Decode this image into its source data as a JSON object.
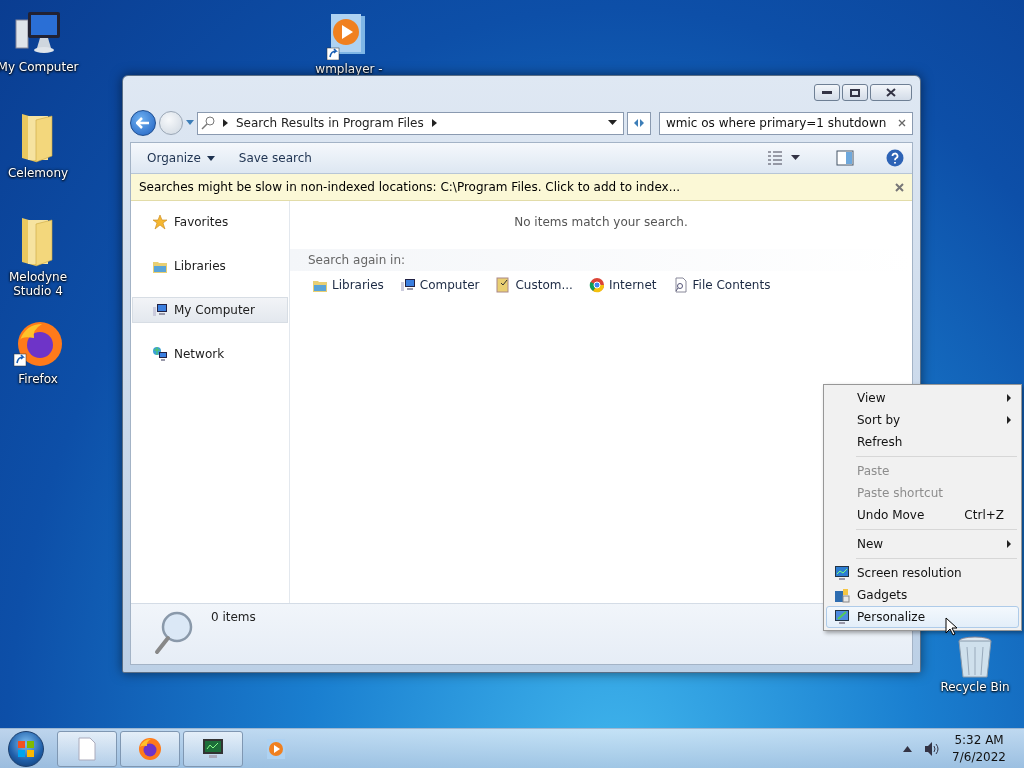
{
  "desktop_icons": [
    {
      "label": "My Computer",
      "kind": "computer"
    },
    {
      "label": "wmplayer -",
      "kind": "media"
    },
    {
      "label": "Celemony",
      "kind": "folder"
    },
    {
      "label": "Melodyne\nStudio 4",
      "kind": "folder"
    },
    {
      "label": "Firefox",
      "kind": "firefox"
    },
    {
      "label": "Recycle Bin",
      "kind": "recycle"
    }
  ],
  "explorer": {
    "address": "Search Results in Program Files",
    "search_value": "wmic os where primary=1 shutdown",
    "toolbar": [
      "Organize",
      "Save search"
    ],
    "info_bar": "Searches might be slow in non-indexed locations: C:\\Program Files. Click to add to index...",
    "nav": [
      {
        "label": "Favorites",
        "kind": "star",
        "selected": false
      },
      {
        "label": "Libraries",
        "kind": "library",
        "selected": false
      },
      {
        "label": "My Computer",
        "kind": "computer",
        "selected": true
      },
      {
        "label": "Network",
        "kind": "network",
        "selected": false
      }
    ],
    "empty_message": "No items match your search.",
    "search_again_label": "Search again in:",
    "search_again": [
      {
        "label": "Libraries",
        "kind": "library"
      },
      {
        "label": "Computer",
        "kind": "computer"
      },
      {
        "label": "Custom...",
        "kind": "custom"
      },
      {
        "label": "Internet",
        "kind": "internet"
      },
      {
        "label": "File Contents",
        "kind": "file"
      }
    ],
    "status": "0 items"
  },
  "context_menu": [
    [
      {
        "label": "View",
        "kind": "plain",
        "submenu": true,
        "disabled": false,
        "selected": false
      },
      {
        "label": "Sort by",
        "kind": "plain",
        "submenu": true,
        "disabled": false,
        "selected": false
      },
      {
        "label": "Refresh",
        "kind": "plain",
        "submenu": false,
        "disabled": false,
        "selected": false
      }
    ],
    [
      {
        "label": "Paste",
        "kind": "plain",
        "submenu": false,
        "disabled": true,
        "selected": false
      },
      {
        "label": "Paste shortcut",
        "kind": "plain",
        "submenu": false,
        "disabled": true,
        "selected": false
      },
      {
        "label": "Undo Move",
        "kind": "plain",
        "shortcut": "Ctrl+Z",
        "submenu": false,
        "disabled": false,
        "selected": false
      }
    ],
    [
      {
        "label": "New",
        "kind": "plain",
        "submenu": true,
        "disabled": false,
        "selected": false
      }
    ],
    [
      {
        "label": "Screen resolution",
        "kind": "screen",
        "submenu": false,
        "disabled": false,
        "selected": false
      },
      {
        "label": "Gadgets",
        "kind": "gadgets",
        "submenu": false,
        "disabled": false,
        "selected": false
      },
      {
        "label": "Personalize",
        "kind": "personalize",
        "submenu": false,
        "disabled": false,
        "selected": true
      }
    ]
  ],
  "taskbar": {
    "apps": [
      {
        "kind": "document",
        "pinned": true
      },
      {
        "kind": "firefox",
        "pinned": true
      },
      {
        "kind": "monitor",
        "pinned": true
      },
      {
        "kind": "media",
        "pinned": false
      }
    ],
    "time": "5:32 AM",
    "date": "7/6/2022"
  }
}
